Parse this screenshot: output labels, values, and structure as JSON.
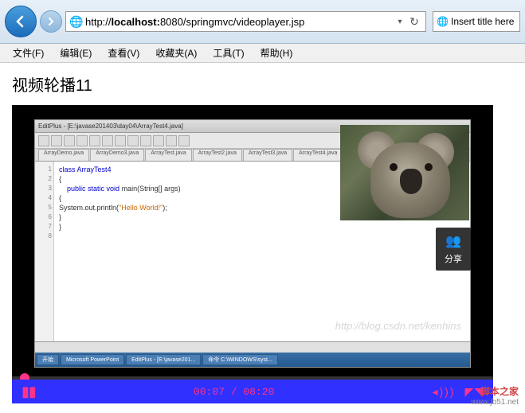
{
  "browser": {
    "url_prefix": "http://",
    "url_host": "localhost:",
    "url_port": "8080",
    "url_path": "/springmvc/videoplayer.jsp",
    "tab_title": "Insert title here"
  },
  "menu": {
    "file": "文件(F)",
    "edit": "编辑(E)",
    "view": "查看(V)",
    "favorites": "收藏夹(A)",
    "tools": "工具(T)",
    "help": "帮助(H)"
  },
  "page": {
    "title": "视频轮播11"
  },
  "ide": {
    "title": "EditPlus - [E:\\javase201403\\day04\\ArrayTest4.java]",
    "tabs": [
      "ArrayDemo.java",
      "ArrayDemo3.java",
      "ArrayTest.java",
      "ArrayTest2.java",
      "ArrayTest3.java",
      "ArrayTest4.java"
    ],
    "code_line1": "class ArrayTest4",
    "code_line2": "{",
    "code_line3_kw": "public static void",
    "code_line3_rest": " main(String[] args)",
    "code_line4": "    {",
    "code_line5_a": "        System.out.println(",
    "code_line5_str": "\"Hello World!\"",
    "code_line5_b": ");",
    "code_line6": "    }",
    "code_line7": "}",
    "taskbar": [
      "开始",
      "Microsoft PowerPoint",
      "EditPlus - [E:\\javase201...",
      "命令 C:\\WINDOWS\\syst..."
    ]
  },
  "share": {
    "label": "分享"
  },
  "watermark_csdn": "http://blog.csdn.net/kenhins",
  "player": {
    "current_time": "00:07",
    "duration": "08:20",
    "time_display": "00:07 / 08:20"
  },
  "footer": {
    "site": "脚本之家",
    "url": "www.jb51.net"
  }
}
